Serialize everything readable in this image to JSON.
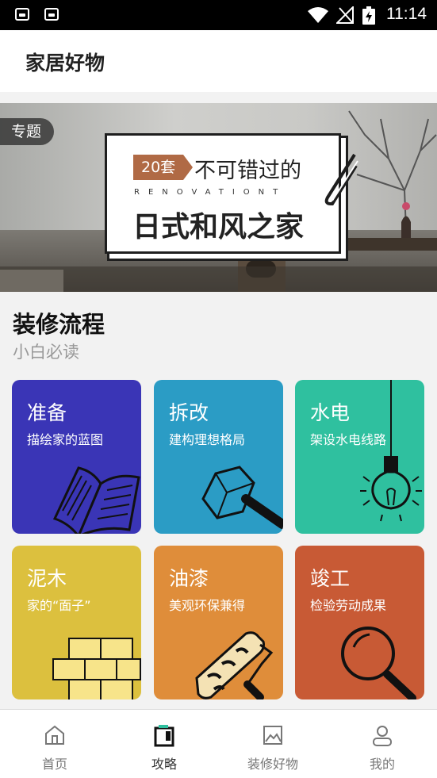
{
  "status_bar": {
    "time": "11:14"
  },
  "header": {
    "title": "家居好物"
  },
  "banner": {
    "tag": "专题",
    "count_label": "20套",
    "headline": "不可错过的",
    "english": "RENOVATIONT",
    "title": "日式和风之家"
  },
  "section": {
    "title": "装修流程",
    "subtitle": "小白必读"
  },
  "cards": [
    {
      "title": "准备",
      "subtitle": "描绘家的蓝图",
      "color": "#3a35b6",
      "icon": "open-book-icon"
    },
    {
      "title": "拆改",
      "subtitle": "建构理想格局",
      "color": "#2b9cc5",
      "icon": "hammer-icon"
    },
    {
      "title": "水电",
      "subtitle": "架设水电线路",
      "color": "#2fc09f",
      "icon": "light-bulb-icon"
    },
    {
      "title": "泥木",
      "subtitle": "家的“面子”",
      "color": "#dcc03e",
      "icon": "brick-wall-icon"
    },
    {
      "title": "油漆",
      "subtitle": "美观环保兼得",
      "color": "#df8d3a",
      "icon": "paint-roller-icon"
    },
    {
      "title": "竣工",
      "subtitle": "检验劳动成果",
      "color": "#c85a35",
      "icon": "magnifier-icon"
    }
  ],
  "bottom_nav": [
    {
      "label": "首页",
      "icon": "home-icon",
      "active": false
    },
    {
      "label": "攻略",
      "icon": "guide-icon",
      "active": true
    },
    {
      "label": "装修好物",
      "icon": "picture-icon",
      "active": false
    },
    {
      "label": "我的",
      "icon": "user-icon",
      "active": false
    }
  ]
}
